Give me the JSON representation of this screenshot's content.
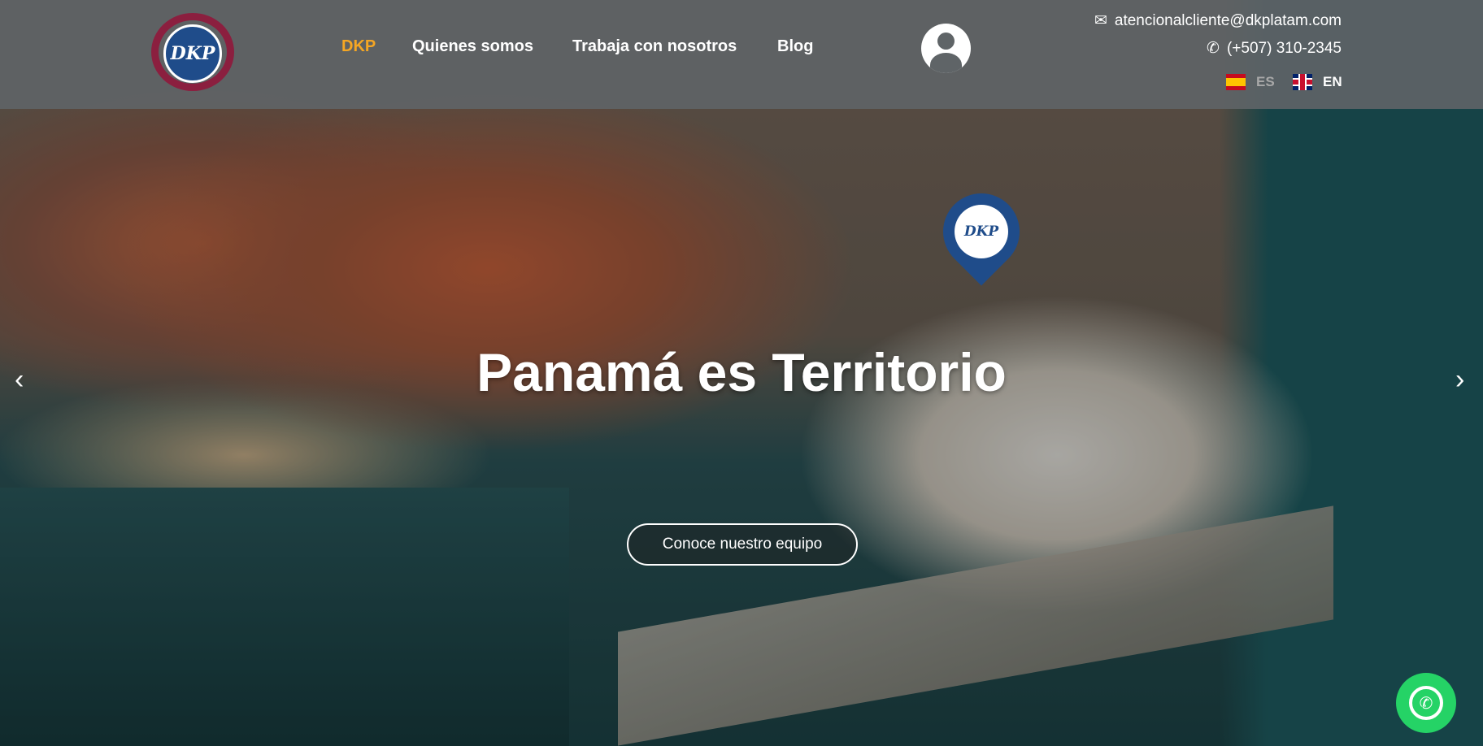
{
  "header": {
    "logo_text": "DKP",
    "nav": [
      {
        "label": "DKP",
        "active": true
      },
      {
        "label": "Quienes somos"
      },
      {
        "label": "Trabaja con nosotros"
      },
      {
        "label": "Blog"
      }
    ],
    "email": "atencionalcliente@dkplatam.com",
    "phone": "(+507) 310-2345",
    "languages": [
      {
        "code": "ES",
        "active": false
      },
      {
        "code": "EN",
        "active": true
      }
    ]
  },
  "hero": {
    "title": "Panamá es Territorio",
    "cta": "Conoce nuestro equipo",
    "pin_text": "DKP",
    "prev": "‹",
    "next": "›"
  },
  "colors": {
    "accent": "#f5a623",
    "whatsapp": "#25d366",
    "brand_blue": "#1f4c8a",
    "brand_red": "#8b1f3f"
  }
}
